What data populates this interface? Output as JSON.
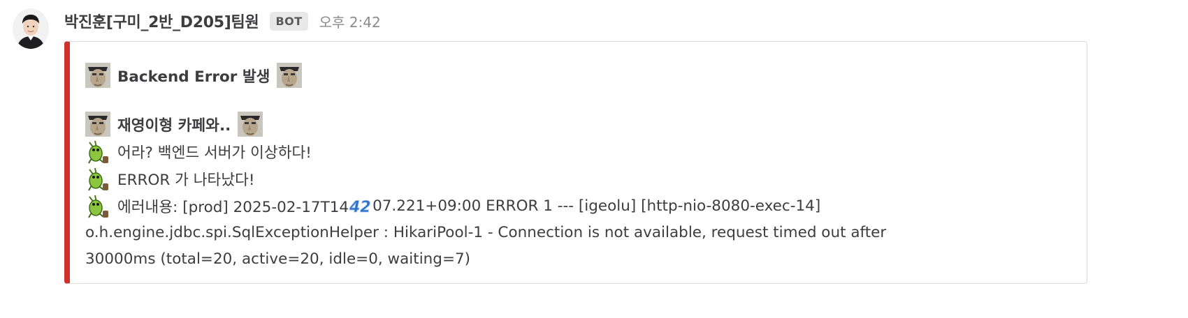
{
  "message": {
    "username": "박진훈[구미_2반_D205]팀원",
    "badge": "BOT",
    "time": "오후 2:42"
  },
  "attachment": {
    "accent_color": "#d0312d",
    "title": "Backend Error 발생",
    "subtitle": "재영이형 카페와..",
    "lines": [
      "어라? 백엔드 서버가 이상하다!",
      "ERROR 가 나타났다!"
    ],
    "error_prefix": "에러내용: [prod] 2025-02-17T14",
    "error_overlay": "42",
    "error_rest": "07.221+09:00 ERROR 1 --- [igeolu] [http-nio-8080-exec-14]",
    "error_line2": "o.h.engine.jdbc.spi.SqlExceptionHelper   : HikariPool-1 - Connection is not available, request timed out after",
    "error_line3": "30000ms (total=20, active=20, idle=0, waiting=7)"
  },
  "icons": {
    "face_emoji": "custom-face-emoji",
    "bug_emoji": "custom-bug-emoji"
  }
}
